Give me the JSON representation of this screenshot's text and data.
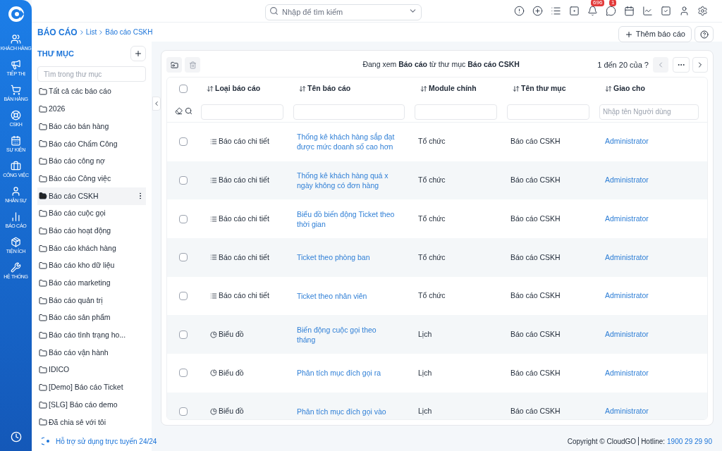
{
  "nav": [
    {
      "kind": "customers",
      "label": "KHÁCH HÀNG"
    },
    {
      "kind": "marketing",
      "label": "TIẾP THỊ"
    },
    {
      "kind": "sales",
      "label": "BÁN HÀNG"
    },
    {
      "kind": "support",
      "label": "CSKH"
    },
    {
      "kind": "events",
      "label": "SỰ KIỆN"
    },
    {
      "kind": "work",
      "label": "CÔNG VIỆC"
    },
    {
      "kind": "hr",
      "label": "NHÂN SỰ"
    },
    {
      "kind": "reports",
      "label": "BÁO CÁO"
    },
    {
      "kind": "utilities",
      "label": "TIỆN ÍCH"
    },
    {
      "kind": "system",
      "label": "HỆ THỐNG"
    }
  ],
  "search": {
    "placeholder": "Nhập để tìm kiếm"
  },
  "toolbar": [
    {
      "kind": "alert"
    },
    {
      "kind": "add"
    },
    {
      "kind": "list"
    },
    {
      "kind": "status"
    },
    {
      "kind": "bell",
      "badge": "696"
    },
    {
      "kind": "chat",
      "badge": "1"
    },
    {
      "kind": "calendar"
    },
    {
      "kind": "chart"
    },
    {
      "kind": "tasks"
    },
    {
      "kind": "user"
    },
    {
      "kind": "settings"
    }
  ],
  "breadcrumb": [
    "BÁO CÁO",
    "List",
    "Báo cáo CSKH"
  ],
  "add_button": "Thêm báo cáo",
  "folders_panel": {
    "title": "THƯ MỤC",
    "search_placeholder": "Tìm trong thư mục",
    "folders": [
      {
        "name": "Tất cả các báo cáo",
        "selected": false
      },
      {
        "name": "2026",
        "selected": false
      },
      {
        "name": "Báo cáo bán hàng",
        "selected": false
      },
      {
        "name": "Báo cáo Chấm Công",
        "selected": false
      },
      {
        "name": "Báo cáo công nợ",
        "selected": false
      },
      {
        "name": "Báo cáo Công việc",
        "selected": false
      },
      {
        "name": "Báo cáo CSKH",
        "selected": true
      },
      {
        "name": "Báo cáo cuộc gọi",
        "selected": false
      },
      {
        "name": "Báo cáo hoạt động",
        "selected": false
      },
      {
        "name": "Báo cáo khách hàng",
        "selected": false
      },
      {
        "name": "Báo cáo kho dữ liệu",
        "selected": false
      },
      {
        "name": "Báo cáo marketing",
        "selected": false
      },
      {
        "name": "Báo cáo quản trị",
        "selected": false
      },
      {
        "name": "Báo cáo sản phẩm",
        "selected": false
      },
      {
        "name": "Báo cáo tình trạng ho...",
        "selected": false
      },
      {
        "name": "Báo cáo vận hành",
        "selected": false
      },
      {
        "name": "IDICO",
        "selected": false
      },
      {
        "name": "[Demo] Báo cáo Ticket",
        "selected": false
      },
      {
        "name": "[SLG] Báo cáo demo",
        "selected": false
      },
      {
        "name": "Đã chia sẻ với tôi",
        "selected": false
      }
    ]
  },
  "viewing": "Đang xem **Báo cáo** từ thư mục **Báo cáo CSKH**",
  "pagination": "1 đến 20 của ?",
  "table": {
    "columns": [
      "Loại báo cáo",
      "Tên báo cáo",
      "Module chính",
      "Tên thư mục",
      "Giao cho"
    ],
    "filter_placeholder": "Nhập tên Người dùng",
    "select_all_checked": false,
    "rows": [
      {
        "type": "Báo cáo chi tiết",
        "kind": "detail",
        "name": "Thống kê khách hàng sắp đạt được mức doanh số cao hơn",
        "module": "Tổ chức",
        "folder": "Báo cáo CSKH",
        "assignee": "Administrator",
        "checked": false
      },
      {
        "type": "Báo cáo chi tiết",
        "kind": "detail",
        "name": "Thống kê khách hàng quá x ngày không có đơn hàng",
        "module": "Tổ chức",
        "folder": "Báo cáo CSKH",
        "assignee": "Administrator",
        "checked": false
      },
      {
        "type": "Báo cáo chi tiết",
        "kind": "detail",
        "name": "Biểu đồ biến động Ticket theo thời gian",
        "module": "Tổ chức",
        "folder": "Báo cáo CSKH",
        "assignee": "Administrator",
        "checked": false
      },
      {
        "type": "Báo cáo chi tiết",
        "kind": "detail",
        "name": "Ticket theo phòng ban",
        "module": "Tổ chức",
        "folder": "Báo cáo CSKH",
        "assignee": "Administrator",
        "checked": false
      },
      {
        "type": "Báo cáo chi tiết",
        "kind": "detail",
        "name": "Ticket theo nhân viên",
        "module": "Tổ chức",
        "folder": "Báo cáo CSKH",
        "assignee": "Administrator",
        "checked": false
      },
      {
        "type": "Biểu đồ",
        "kind": "chart",
        "name": "Biến động cuộc gọi theo tháng",
        "module": "Lịch",
        "folder": "Báo cáo CSKH",
        "assignee": "Administrator",
        "checked": false
      },
      {
        "type": "Biểu đồ",
        "kind": "chart",
        "name": "Phân tích mục đích gọi ra",
        "module": "Lịch",
        "folder": "Báo cáo CSKH",
        "assignee": "Administrator",
        "checked": false
      },
      {
        "type": "Biểu đồ",
        "kind": "chart",
        "name": "Phân tích mục đích gọi vào",
        "module": "Lịch",
        "folder": "Báo cáo CSKH",
        "assignee": "Administrator",
        "checked": false
      }
    ]
  },
  "footer": {
    "support": "Hỗ trợ sử dụng trực tuyến 24/24",
    "copyright": "Copyright © CloudGO",
    "hotline_label": "Hotline:",
    "hotline": "1900 29 29 90"
  }
}
